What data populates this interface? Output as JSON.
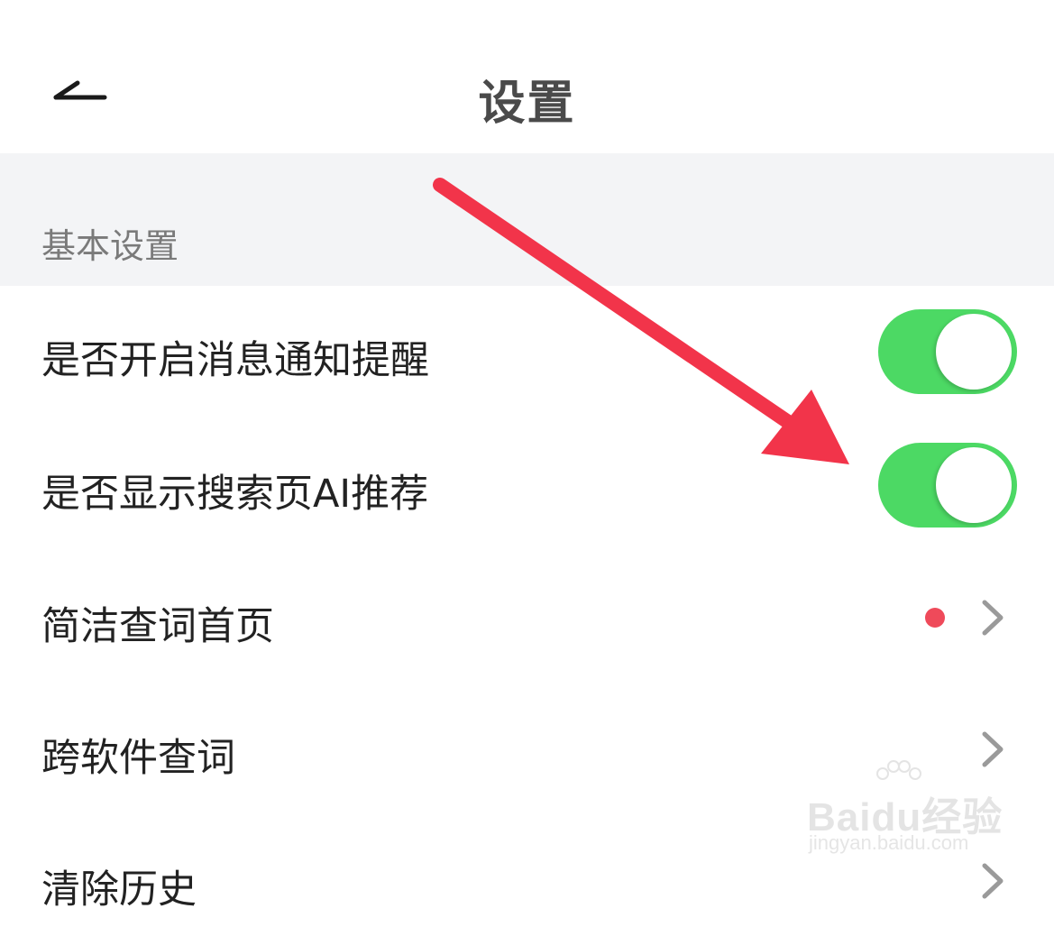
{
  "header": {
    "title": "设置",
    "back_icon": "back-arrow-icon"
  },
  "section": {
    "title": "基本设置"
  },
  "rows": [
    {
      "label": "是否开启消息通知提醒",
      "control": "toggle",
      "on": true
    },
    {
      "label": "是否显示搜索页AI推荐",
      "control": "toggle",
      "on": true
    },
    {
      "label": "简洁查词首页",
      "control": "chevron",
      "badge": "red-dot"
    },
    {
      "label": "跨软件查词",
      "control": "chevron"
    },
    {
      "label": "清除历史",
      "control": "chevron"
    }
  ],
  "colors": {
    "toggle_on": "#4cd964",
    "badge": "#ef4a5a",
    "annotation_arrow": "#f2344a",
    "section_bg": "#f3f4f6"
  },
  "watermark": {
    "logo": "Baidu经验",
    "url": "jingyan.baidu.com"
  }
}
